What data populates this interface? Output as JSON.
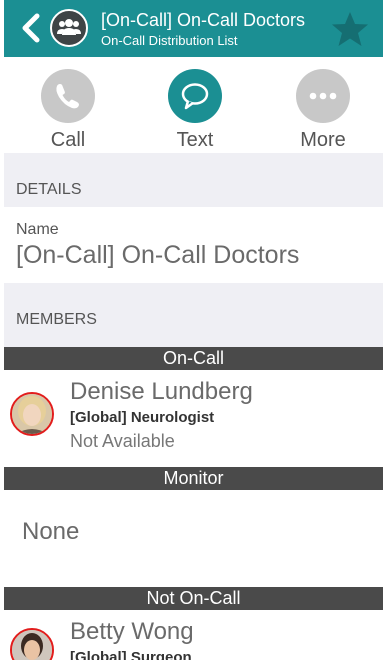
{
  "header": {
    "title": "[On-Call] On-Call Doctors",
    "subtitle": "On-Call Distribution List",
    "icons": {
      "back": "back-chevron-icon",
      "group": "group-icon",
      "favorite": "star-icon"
    },
    "colors": {
      "bar": "#1b8f93",
      "star": "#156e72"
    }
  },
  "actions": [
    {
      "label": "Call",
      "icon": "phone-icon",
      "color": "#c8c8c8"
    },
    {
      "label": "Text",
      "icon": "chat-bubble-icon",
      "color": "#1b8f93"
    },
    {
      "label": "More",
      "icon": "more-dots-icon",
      "color": "#c8c8c8"
    }
  ],
  "details": {
    "section_label": "DETAILS",
    "name_label": "Name",
    "name_value": "[On-Call] On-Call Doctors"
  },
  "members": {
    "section_label": "MEMBERS",
    "groups": [
      {
        "label": "On-Call",
        "people": [
          {
            "name": "Denise Lundberg",
            "role": "[Global] Neurologist",
            "status": "Not Available"
          }
        ]
      },
      {
        "label": "Monitor",
        "empty_text": "None"
      },
      {
        "label": "Not On-Call",
        "people": [
          {
            "name": "Betty Wong",
            "role": "[Global] Surgeon"
          }
        ]
      }
    ]
  }
}
